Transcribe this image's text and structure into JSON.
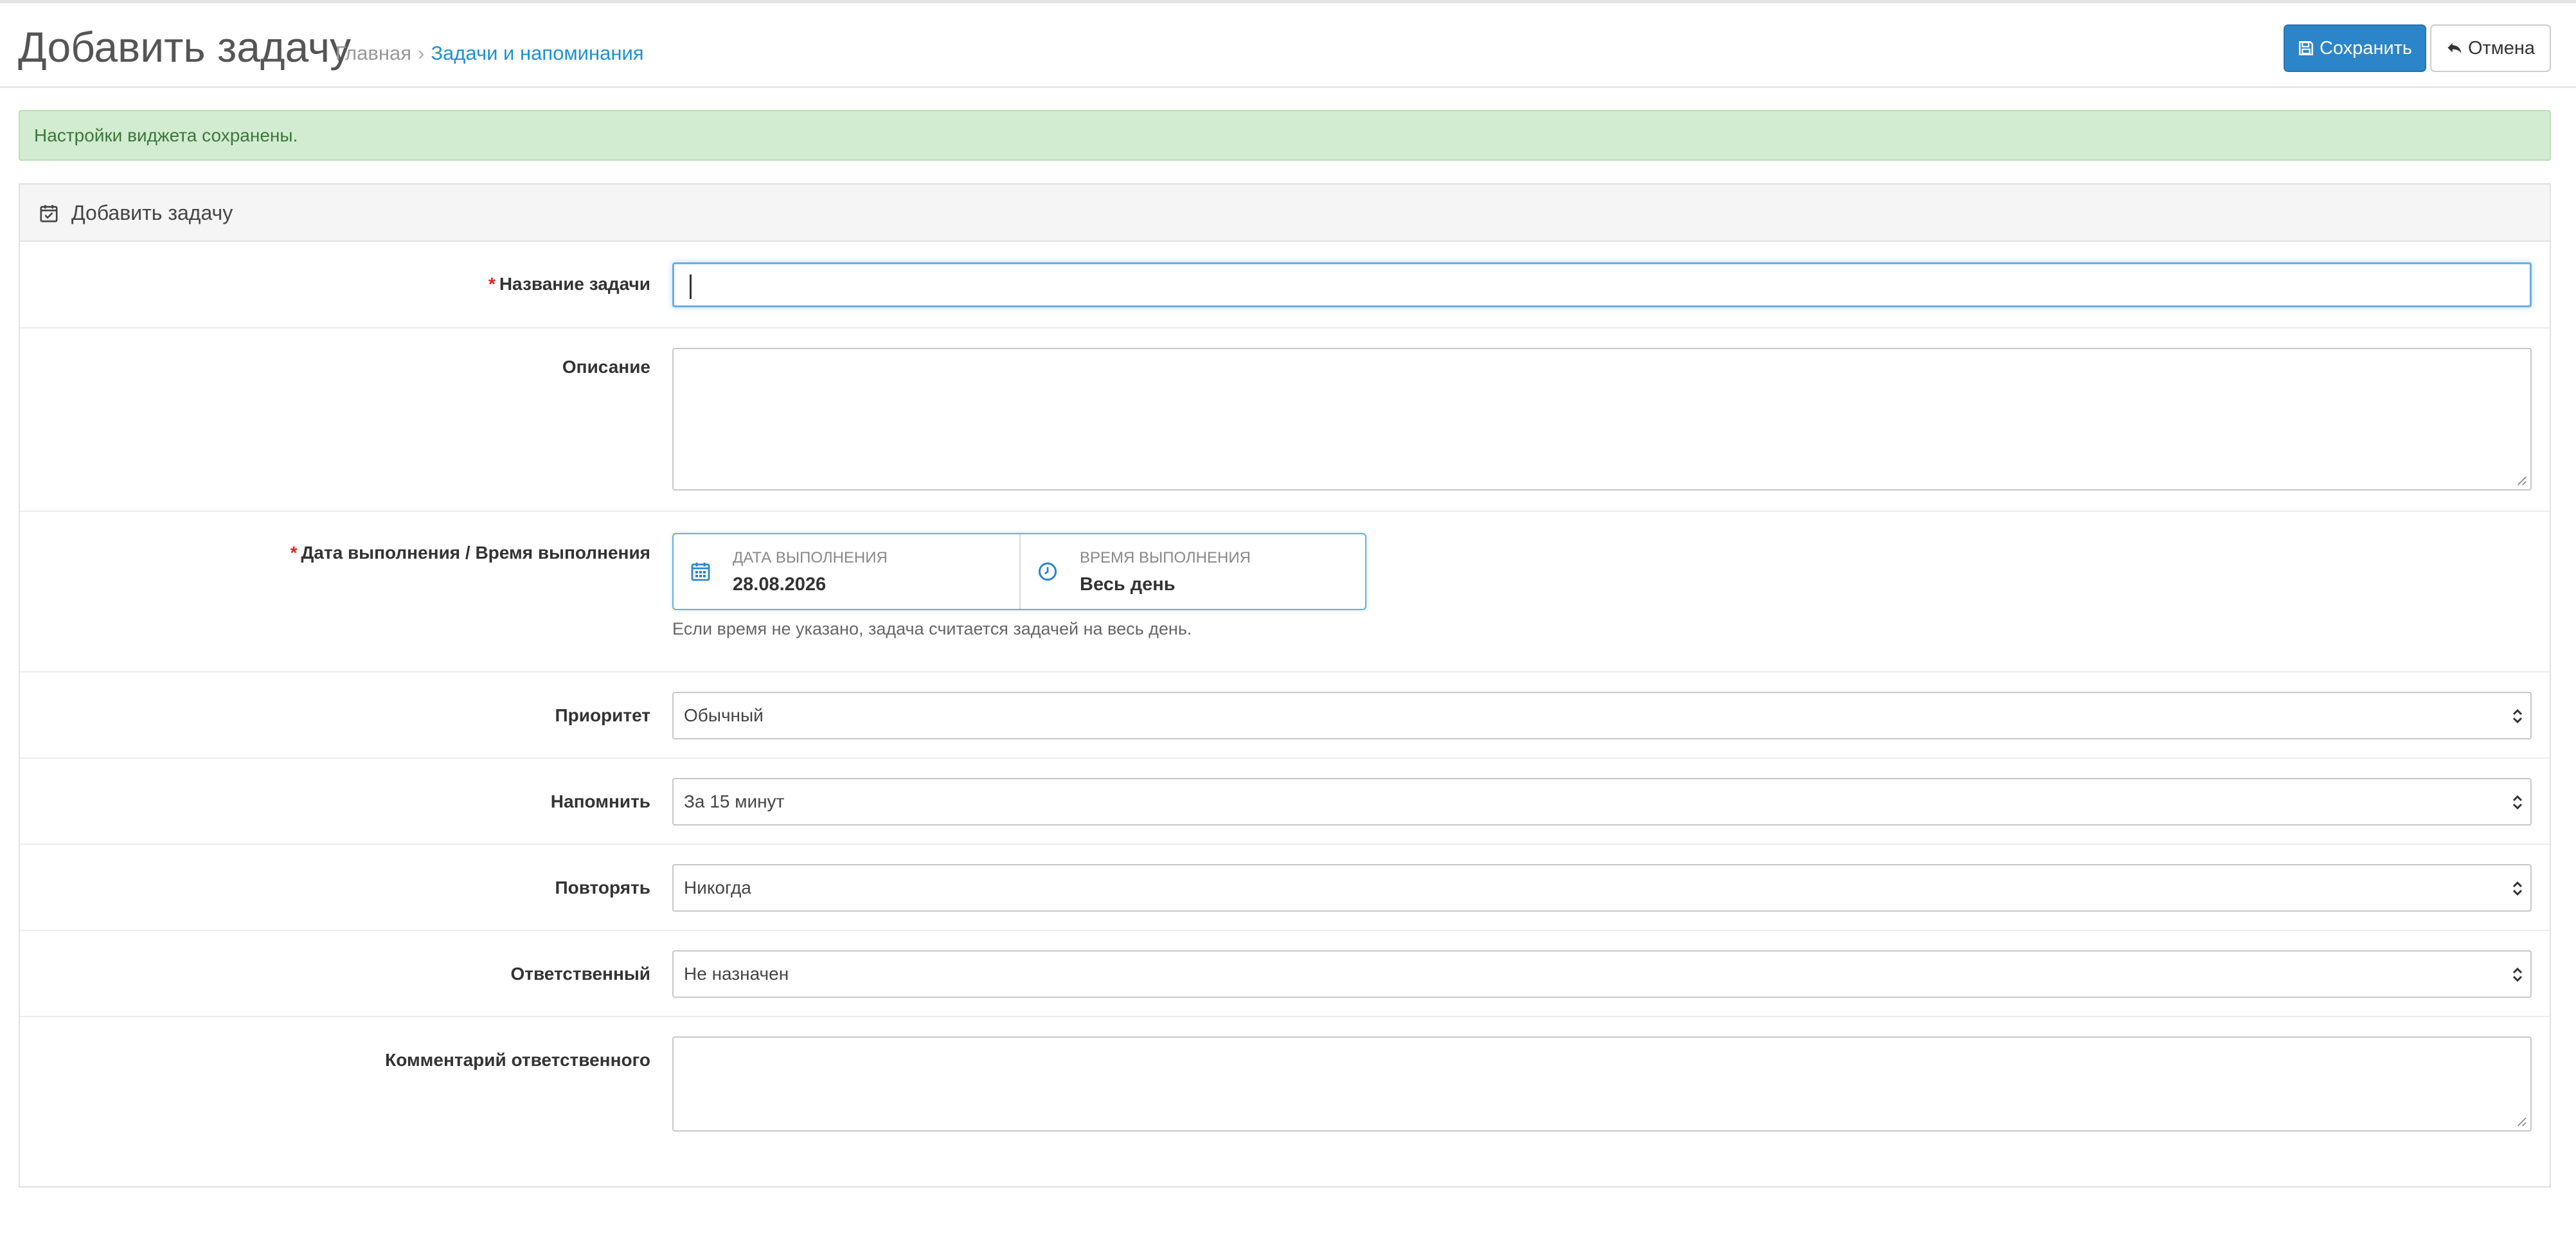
{
  "header": {
    "title": "Добавить задачу",
    "breadcrumb": [
      {
        "label": "Главная"
      },
      {
        "label": "Задачи и напоминания"
      }
    ],
    "breadcrumb_separator": "›",
    "save_label": "Сохранить",
    "cancel_label": "Отмена"
  },
  "alert": {
    "text": "Настройки виджета сохранены.",
    "color": "#3c763d"
  },
  "panel": {
    "title": "Добавить задачу"
  },
  "form": {
    "task_name": {
      "label": "Название задачи",
      "required": true,
      "value": ""
    },
    "description": {
      "label": "Описание",
      "value": ""
    },
    "due": {
      "label": "Дата выполнения / Время выполнения",
      "required": true,
      "date_caption": "ДАТА ВЫПОЛНЕНИЯ",
      "date_value": "28.08.2026",
      "time_caption": "ВРЕМЯ ВЫПОЛНЕНИЯ",
      "time_value": "Весь день",
      "help": "Если время не указано, задача считается задачей на весь день."
    },
    "priority": {
      "label": "Приоритет",
      "value": "Обычный"
    },
    "remind": {
      "label": "Напомнить",
      "value": "За 15 минут"
    },
    "repeat": {
      "label": "Повторять",
      "value": "Никогда"
    },
    "assignee": {
      "label": "Ответственный",
      "value": "Не назначен"
    },
    "assignee_comment": {
      "label": "Комментарий ответственного",
      "value": ""
    }
  },
  "colors": {
    "primary": "#2c85c8",
    "link": "#1e91cf",
    "required": "#e3211e",
    "success_bg": "#d1ecd0"
  }
}
